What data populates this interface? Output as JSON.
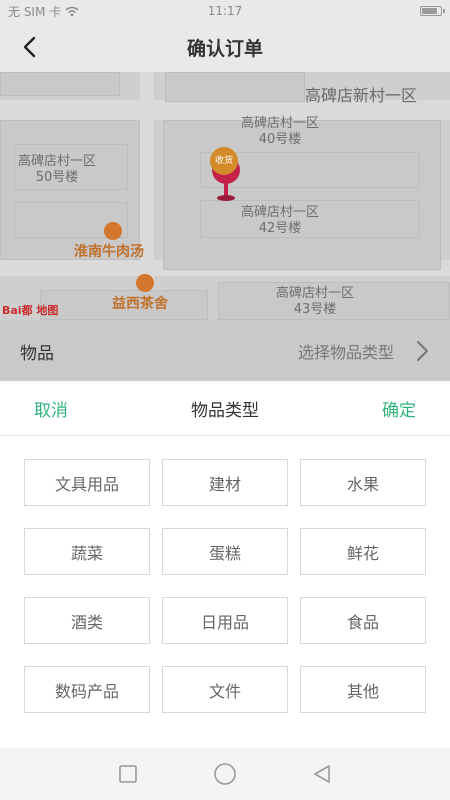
{
  "status": {
    "carrier": "无 SIM 卡",
    "time": "11:17",
    "battery_level": 0.9
  },
  "header": {
    "title": "确认订单",
    "back_icon": "chevron-left-icon"
  },
  "map": {
    "labels": {
      "top_right": "高碑店新村一区",
      "b40": "高碑店村一区\n40号楼",
      "b50": "高碑店村一区\n50号楼",
      "b42": "高碑店村一区\n42号楼",
      "b43": "高碑店村一区\n43号楼"
    },
    "pois": {
      "beef_soup": "淮南牛肉汤",
      "tea_house": "益西茶舍"
    },
    "pin_label": "收货",
    "logo": "Bai都 地图"
  },
  "item_row": {
    "label": "物品",
    "value": "选择物品类型"
  },
  "picker": {
    "cancel": "取消",
    "title": "物品类型",
    "confirm": "确定",
    "options": [
      "文具用品",
      "建材",
      "水果",
      "蔬菜",
      "蛋糕",
      "鲜花",
      "酒类",
      "日用品",
      "食品",
      "数码产品",
      "文件",
      "其他"
    ]
  },
  "colors": {
    "accent": "#2fb27d",
    "poi": "#c0722d",
    "pin": "#c4224a"
  }
}
